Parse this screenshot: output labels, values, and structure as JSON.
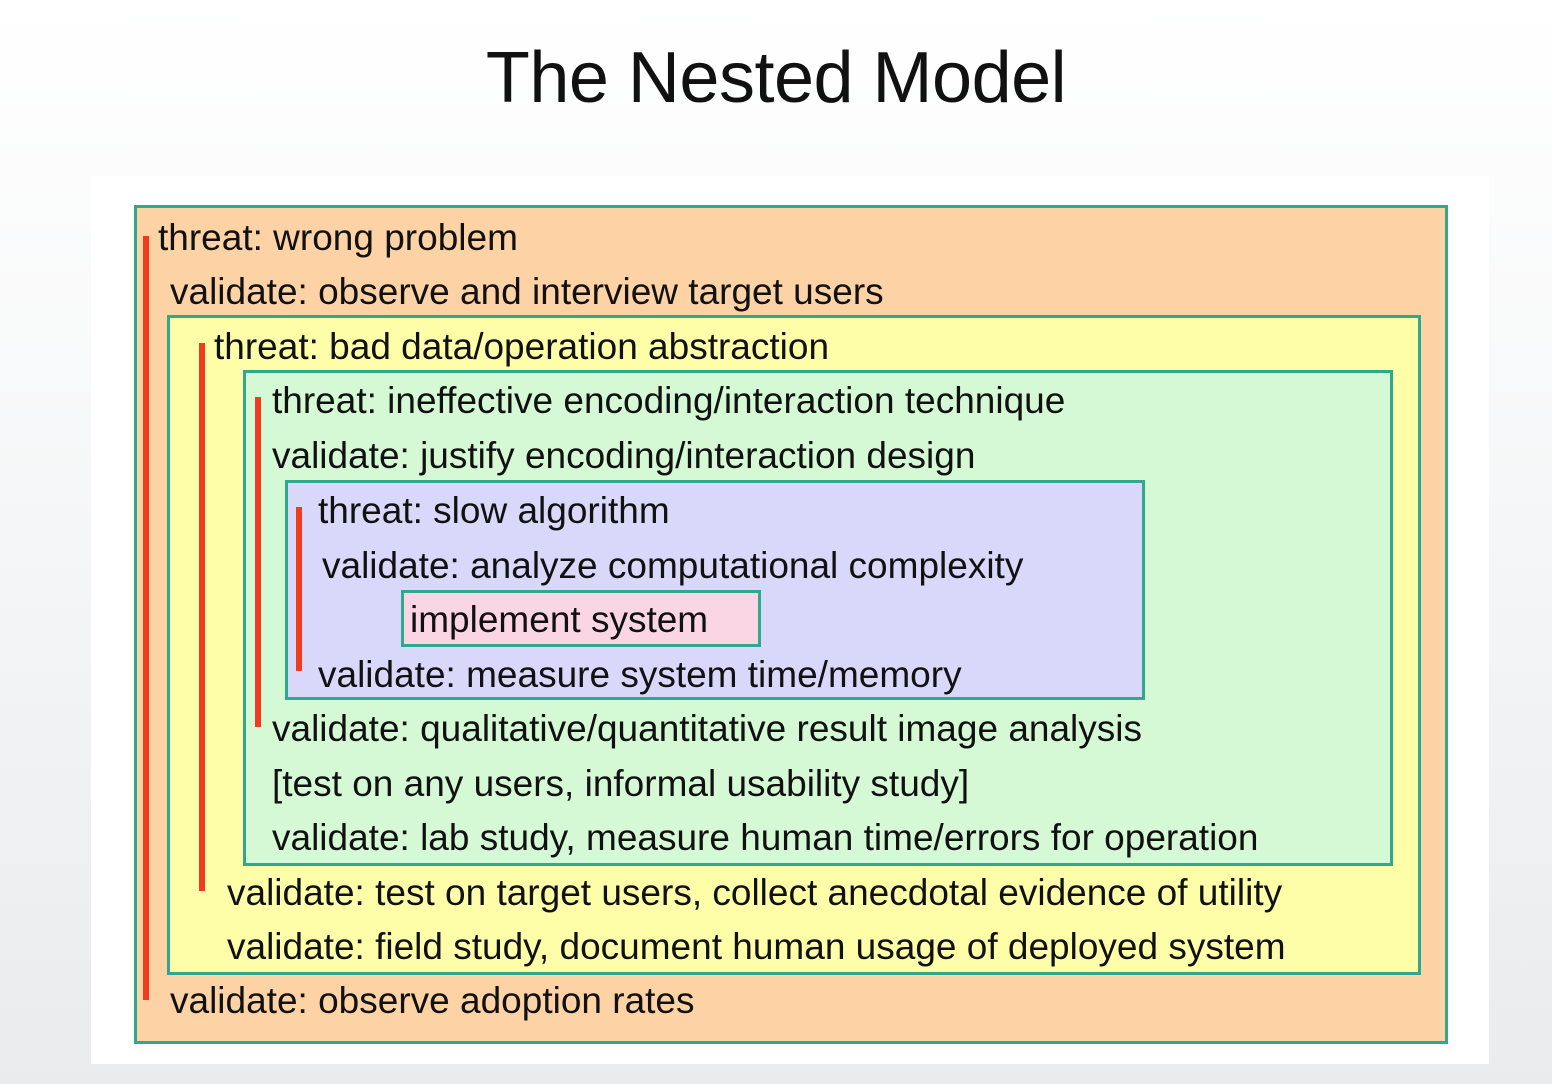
{
  "title": "The Nested Model",
  "colors": {
    "outer_box": "#fdd2a5",
    "yellow_box": "#fefea8",
    "green_box": "#d5f9d5",
    "blue_box": "#d9d7fa",
    "pink_box": "#fad5e3",
    "box_border": "#2fa88e",
    "bar": "#f23a1f"
  },
  "levels": {
    "domain": {
      "threat": "threat: wrong problem",
      "validate_top": "validate: observe and interview target users",
      "validate_bottom": "validate: observe adoption rates"
    },
    "abstraction": {
      "threat": "threat: bad data/operation abstraction",
      "validate_bottom_1": "validate: test on target users, collect anecdotal evidence of utility",
      "validate_bottom_2": "validate: field study, document human usage of deployed system"
    },
    "encoding": {
      "threat": "threat: ineffective encoding/interaction technique",
      "validate_top": "validate: justify encoding/interaction design",
      "validate_bottom_1": "validate: qualitative/quantitative result image analysis",
      "validate_bottom_2": "[test on any users, informal usability study]",
      "validate_bottom_3": "validate: lab study, measure human time/errors for operation"
    },
    "algorithm": {
      "threat": "threat: slow algorithm",
      "validate_top": "validate: analyze computational complexity",
      "core": "implement system",
      "validate_bottom": "validate: measure system time/memory"
    }
  }
}
